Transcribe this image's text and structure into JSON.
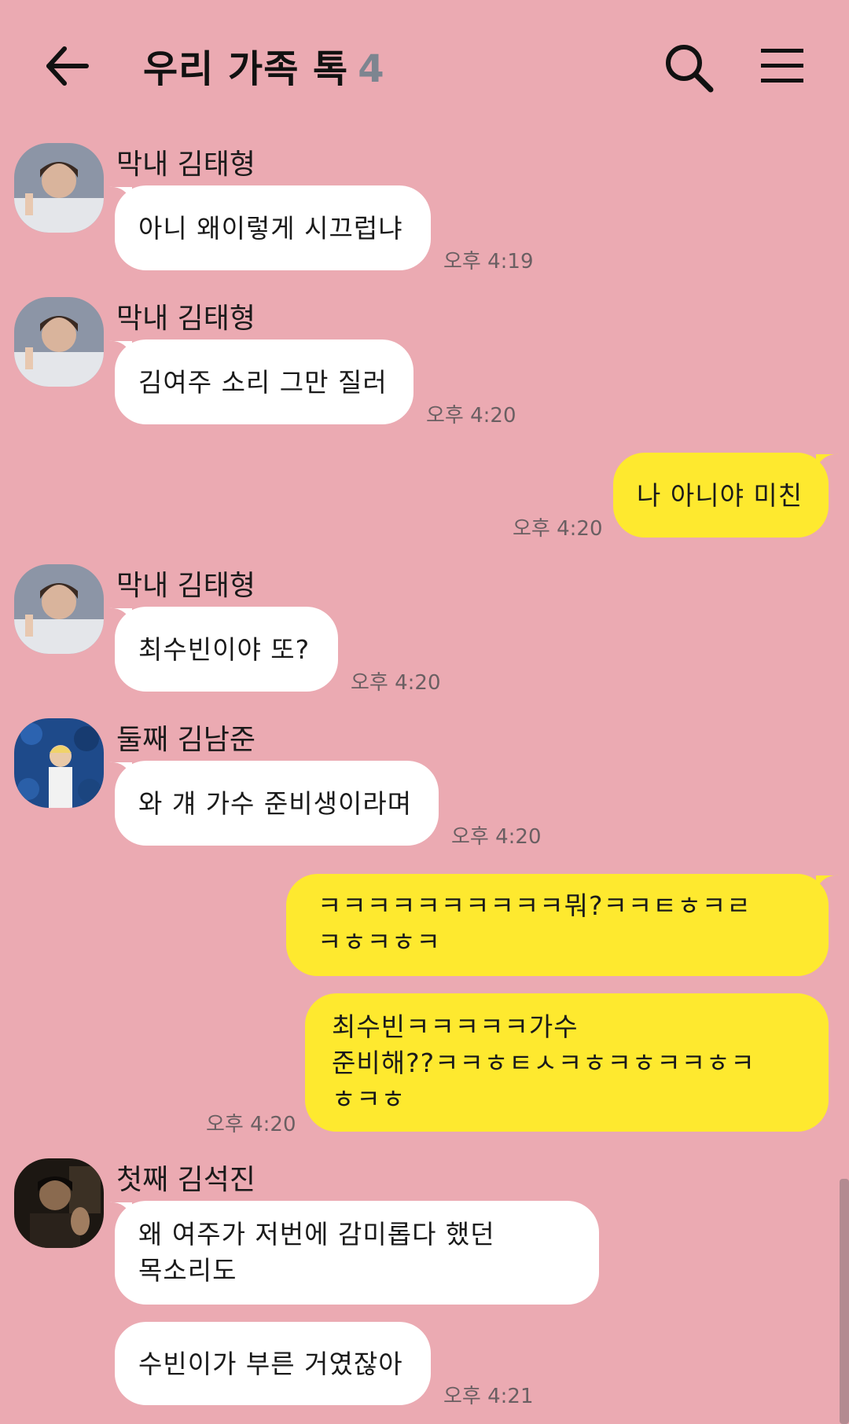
{
  "header": {
    "title": "우리 가족 톡",
    "member_count": "4",
    "back_icon": "arrow-left-icon",
    "search_icon": "search-icon",
    "menu_icon": "hamburger-menu-icon"
  },
  "colors": {
    "background": "#ebaab2",
    "incoming_bubble": "#ffffff",
    "outgoing_bubble": "#fee92f",
    "count_text": "#7d8590"
  },
  "messages": [
    {
      "sender": "막내 김태형",
      "text": "아니 왜이렇게 시끄럽냐",
      "time": "오후 4:19",
      "direction": "in"
    },
    {
      "sender": "막내 김태형",
      "text": "김여주 소리 그만 질러",
      "time": "오후 4:20",
      "direction": "in"
    },
    {
      "sender": "",
      "text": "나 아니야 미친",
      "time": "오후 4:20",
      "direction": "out"
    },
    {
      "sender": "막내 김태형",
      "text": "최수빈이야 또?",
      "time": "오후 4:20",
      "direction": "in"
    },
    {
      "sender": "둘째 김남준",
      "text": "와 걔 가수 준비생이라며",
      "time": "오후 4:20",
      "direction": "in"
    },
    {
      "sender": "",
      "text": "ㅋㅋㅋㅋㅋㅋㅋㅋㅋㅋ뭐?ㅋㅋㅌㅎㅋㄹ\nㅋㅎㅋㅎㅋ",
      "time": "",
      "direction": "out"
    },
    {
      "sender": "",
      "text": "최수빈ㅋㅋㅋㅋㅋ가수\n준비해??ㅋㅋㅎㅌㅅㅋㅎㅋㅎㅋㅋㅎㅋ\nㅎㅋㅎ",
      "time": "오후 4:20",
      "direction": "out"
    },
    {
      "sender": "첫째 김석진",
      "text": "왜 여주가 저번에 감미롭다 했던\n목소리도",
      "time": "",
      "direction": "in"
    },
    {
      "sender": "",
      "text": "수빈이가 부른 거였잖아",
      "time": "오후 4:21",
      "direction": "in"
    }
  ]
}
